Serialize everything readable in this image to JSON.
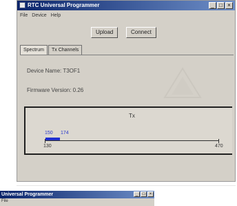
{
  "window": {
    "title": "RTC Universal Programmer",
    "buttons": {
      "minimize": "_",
      "maximize": "□",
      "close": "×"
    }
  },
  "menu": [
    "File",
    "Device",
    "Help"
  ],
  "toolbar": {
    "upload_label": "Upload",
    "connect_label": "Connect"
  },
  "tabs": [
    {
      "label": "Spectrum",
      "active": true
    },
    {
      "label": "Tx Channels",
      "active": false
    }
  ],
  "device": {
    "name_text": "Device Name: T3OF1",
    "firmware_text": "Firmware Version: 0.26"
  },
  "spectrum": {
    "title": "Tx",
    "axis_min": "130",
    "axis_max": "470",
    "range_start": "150",
    "range_end": "174",
    "bar_color": "#1f2fd0"
  },
  "window2": {
    "title": "Universal Programmer",
    "menu_text": "File",
    "buttons": {
      "minimize": "_",
      "maximize": "□",
      "close": "×"
    }
  }
}
